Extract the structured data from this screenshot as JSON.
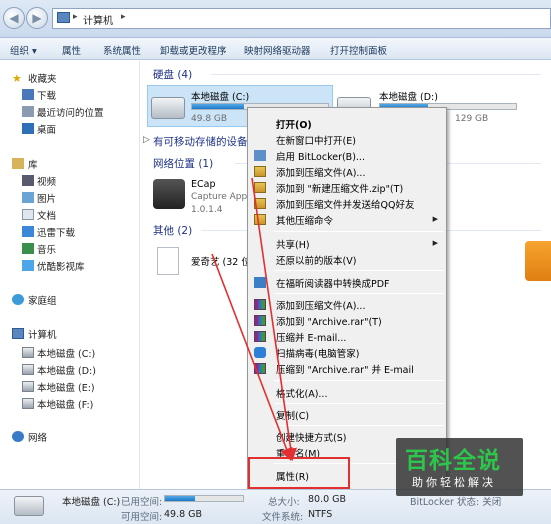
{
  "address": {
    "text": "计算机",
    "sep": "▸",
    "back": "◀",
    "forward": "▶"
  },
  "toolbar": {
    "items": [
      "组织 ▾",
      "属性",
      "系统属性",
      "卸载或更改程序",
      "映射网络驱动器",
      "打开控制面板"
    ]
  },
  "sidebar": {
    "favorites": "收藏夹",
    "fav_items": [
      "下载",
      "最近访问的位置",
      "桌面"
    ],
    "libraries": "库",
    "lib_items": [
      "视频",
      "图片",
      "文档",
      "迅雷下载",
      "音乐",
      "优酷影视库"
    ],
    "homegroup": "家庭组",
    "computer": "计算机",
    "drives": [
      "本地磁盘 (C:)",
      "本地磁盘 (D:)",
      "本地磁盘 (E:)",
      "本地磁盘 (F:)"
    ],
    "network": "网络"
  },
  "content": {
    "group_hdd": "硬盘 (4)",
    "drive_c": {
      "name": "本地磁盘 (C:)",
      "free": "49.8 GB",
      "used_fraction": 0.38
    },
    "drive_d": {
      "name": "本地磁盘 (D:)",
      "free": "129 GB",
      "used_fraction": 0.35
    },
    "group_removable": "有可移动存储的设备",
    "group_network": "网络位置 (1)",
    "ecap": {
      "name": "ECap",
      "sub": "Capture Appl",
      "ver": "1.0.1.4"
    },
    "group_other": "其他 (2)",
    "aiqiyi": "爱奇艺 (32 位"
  },
  "menu": {
    "items": [
      "打开(O)",
      "在新窗口中打开(E)",
      "启用 BitLocker(B)...",
      "添加到压缩文件(A)...",
      "添加到 \"新建压缩文件.zip\"(T)",
      "添加到压缩文件并发送给QQ好友",
      "其他压缩命令",
      "共享(H)",
      "还原以前的版本(V)",
      "在福昕阅读器中转换成PDF",
      "添加到压缩文件(A)...",
      "添加到 \"Archive.rar\"(T)",
      "压缩并 E-mail...",
      "扫描病毒(电脑管家)",
      "压缩到 \"Archive.rar\" 并 E-mail",
      "格式化(A)...",
      "复制(C)",
      "创建快捷方式(S)",
      "重命名(M)",
      "属性(R)"
    ],
    "submenu_arrow": "▶"
  },
  "details": {
    "name": "本地磁盘 (C:)",
    "used_label": "已用空间:",
    "total_label": "总大小:",
    "total": "80.0 GB",
    "free_label": "可用空间:",
    "free": "49.8 GB",
    "fs_label": "文件系统:",
    "fs": "NTFS",
    "bitlocker": "BitLocker 状态: 关闭",
    "used_fraction": 0.38
  },
  "watermark": {
    "title": "百科全说",
    "sub": "助你轻松解决"
  },
  "colors": {
    "highlight": "#e23030",
    "accent": "#1e3287",
    "watermark_green": "#2cc74a"
  }
}
